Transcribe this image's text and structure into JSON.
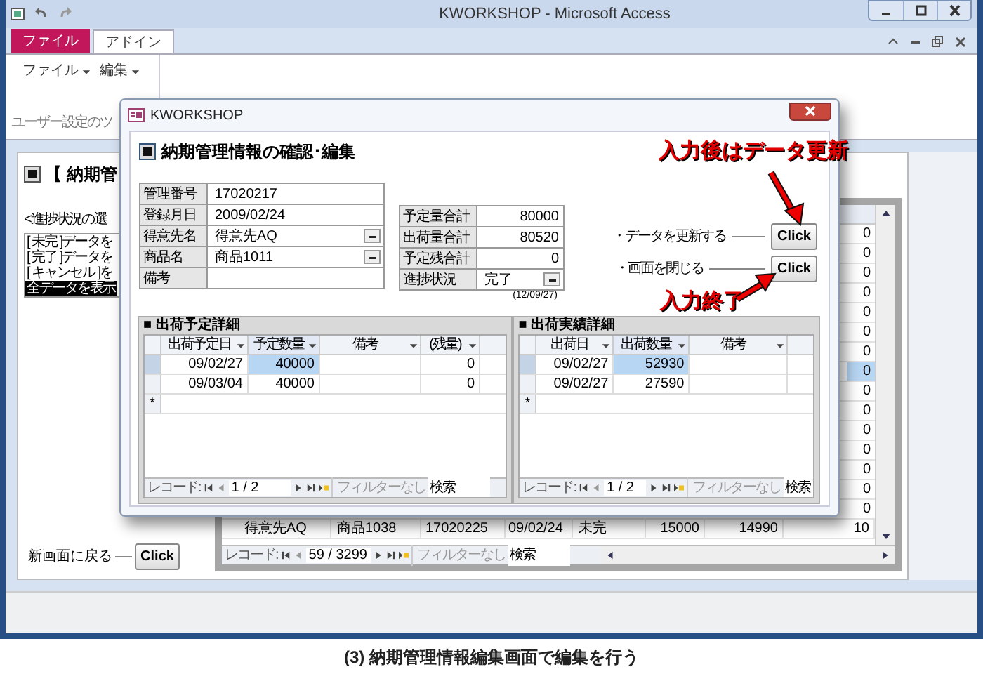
{
  "app_window": {
    "title": "KWORKSHOP - Microsoft Access"
  },
  "ribbon": {
    "tabs": [
      {
        "label": "ファイル",
        "kind": "backstage",
        "selected": false
      },
      {
        "label": "アドイン",
        "kind": "tab",
        "selected": true
      }
    ],
    "menus": [
      {
        "label": "ファイル"
      },
      {
        "label": "編集"
      }
    ],
    "group_label": "ユーザー設定のツ"
  },
  "main_form": {
    "heading": "【 納期管",
    "filter_label": "<進捗状況の選",
    "filter_options": [
      {
        "label": "[ 未完 ]データを",
        "selected": false
      },
      {
        "label": "[ 完了 ]データを",
        "selected": false
      },
      {
        "label": "[ キャンセル ]を",
        "selected": false
      },
      {
        "label": "全データを表示",
        "selected": true
      }
    ],
    "back_label": "新画面に戻る",
    "back_button": "Click"
  },
  "background_table": {
    "side_values": [
      {
        "value": "0",
        "selected": false
      },
      {
        "value": "0",
        "selected": false
      },
      {
        "value": "0",
        "selected": false
      },
      {
        "value": "0",
        "selected": false
      },
      {
        "value": "0",
        "selected": false
      },
      {
        "value": "0",
        "selected": false
      },
      {
        "value": "0",
        "selected": false
      },
      {
        "value": "0",
        "selected": true
      },
      {
        "value": "0",
        "selected": false
      },
      {
        "value": "0",
        "selected": false
      },
      {
        "value": "0",
        "selected": false
      },
      {
        "value": "0",
        "selected": false
      },
      {
        "value": "0",
        "selected": false
      },
      {
        "value": "0",
        "selected": false
      },
      {
        "value": "0",
        "selected": false
      }
    ],
    "rows": [
      {
        "cells": [
          "得意先AQ",
          "商品1038",
          "17020225",
          "09/02/24",
          "未完",
          "15000",
          "14990",
          "10"
        ]
      }
    ],
    "navigation": {
      "label": "レコード:",
      "position": "59 / 3299",
      "filter": "フィルターなし",
      "search": "検索"
    }
  },
  "dialog": {
    "title": "KWORKSHOP",
    "heading": "納期管理情報の確認･編集",
    "fields": [
      {
        "label": "管理番号",
        "value": "17020217",
        "kind": "text"
      },
      {
        "label": "登録月日",
        "value": "2009/02/24",
        "kind": "text"
      },
      {
        "label": "得意先名",
        "value": "得意先AQ",
        "kind": "combo"
      },
      {
        "label": "商品名",
        "value": "商品1011",
        "kind": "combo"
      },
      {
        "label": "備考",
        "kind": "text"
      }
    ],
    "totals": [
      {
        "label": "予定量合計",
        "value": "80000",
        "kind": "number"
      },
      {
        "label": "出荷量合計",
        "value": "80520",
        "kind": "number"
      },
      {
        "label": "予定残合計",
        "value": "0",
        "kind": "number"
      },
      {
        "label": "進捗状況",
        "value": "完了",
        "kind": "combo"
      }
    ],
    "status_date": "(12/09/27)",
    "actions": [
      {
        "label": "・データを更新する",
        "button": "Click"
      },
      {
        "label": "・画面を閉じる",
        "button": "Click"
      }
    ],
    "subforms": [
      {
        "title": "■ 出荷予定詳細",
        "columns": [
          {
            "label": "出荷予定日",
            "focused": false
          },
          {
            "label": "予定数量",
            "focused": true
          },
          {
            "label": "備考",
            "focused": false
          },
          {
            "label": "(残量)",
            "focused": false
          }
        ],
        "rows": [
          {
            "cells": [
              "09/02/27",
              "40000",
              null,
              "0"
            ],
            "selected": true
          },
          {
            "cells": [
              "09/03/04",
              "40000",
              null,
              "0"
            ],
            "selected": false
          }
        ],
        "new_row_marker": "*",
        "navigation": {
          "label": "レコード:",
          "position": "1 / 2",
          "filter": "フィルターなし",
          "search": "検索"
        }
      },
      {
        "title": "■ 出荷実績詳細",
        "columns": [
          {
            "label": "出荷日",
            "focused": false
          },
          {
            "label": "出荷数量",
            "focused": true
          },
          {
            "label": "備考",
            "focused": false
          }
        ],
        "rows": [
          {
            "cells": [
              "09/02/27",
              "52930",
              null
            ],
            "selected": true
          },
          {
            "cells": [
              "09/02/27",
              "27590",
              null
            ],
            "selected": false
          }
        ],
        "new_row_marker": "*",
        "navigation": {
          "label": "レコード:",
          "position": "1 / 2",
          "filter": "フィルターなし",
          "search": "検索"
        }
      }
    ]
  },
  "annotations": [
    {
      "text": "入力後はデータ更新",
      "kind": "down"
    },
    {
      "text": "入力終了",
      "kind": "up"
    }
  ],
  "caption": "(3) 納期管理情報編集画面で編集を行う"
}
